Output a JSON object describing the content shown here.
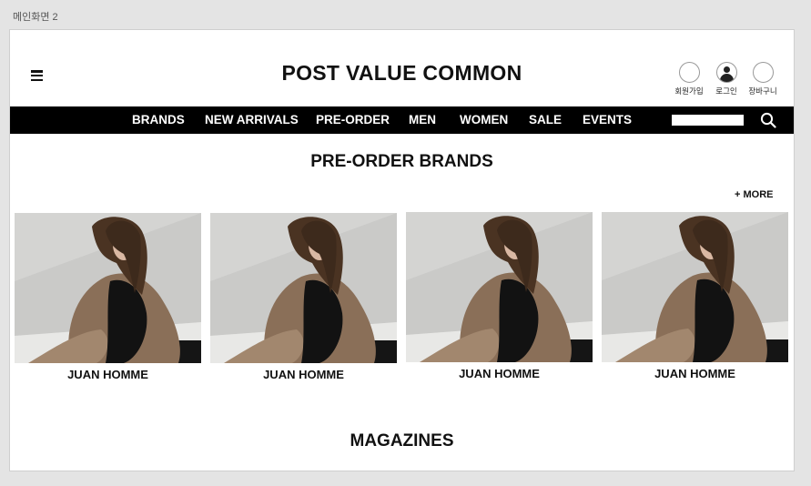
{
  "frame": {
    "label": "메인화면 2"
  },
  "header": {
    "logo": "POST VALUE COMMON",
    "utilities": [
      {
        "label": "회원가입",
        "icon": "signup-icon"
      },
      {
        "label": "로그인",
        "icon": "user-icon"
      },
      {
        "label": "장바구니",
        "icon": "cart-icon"
      }
    ]
  },
  "nav": {
    "items": [
      "BRANDS",
      "NEW ARRIVALS",
      "PRE-ORDER",
      "MEN",
      "WOMEN",
      "SALE",
      "EVENTS"
    ],
    "search": {
      "value": "",
      "placeholder": ""
    }
  },
  "preorder": {
    "title": "PRE-ORDER BRANDS",
    "more": "+ MORE",
    "products": [
      {
        "name": "JUAN HOMME"
      },
      {
        "name": "JUAN HOMME"
      },
      {
        "name": "JUAN HOMME"
      },
      {
        "name": "JUAN HOMME"
      }
    ]
  },
  "magazines": {
    "title": "MAGAZINES"
  },
  "colors": {
    "nav_bg": "#000000",
    "accent_text": "#111111",
    "page_bg": "#e4e4e4"
  }
}
